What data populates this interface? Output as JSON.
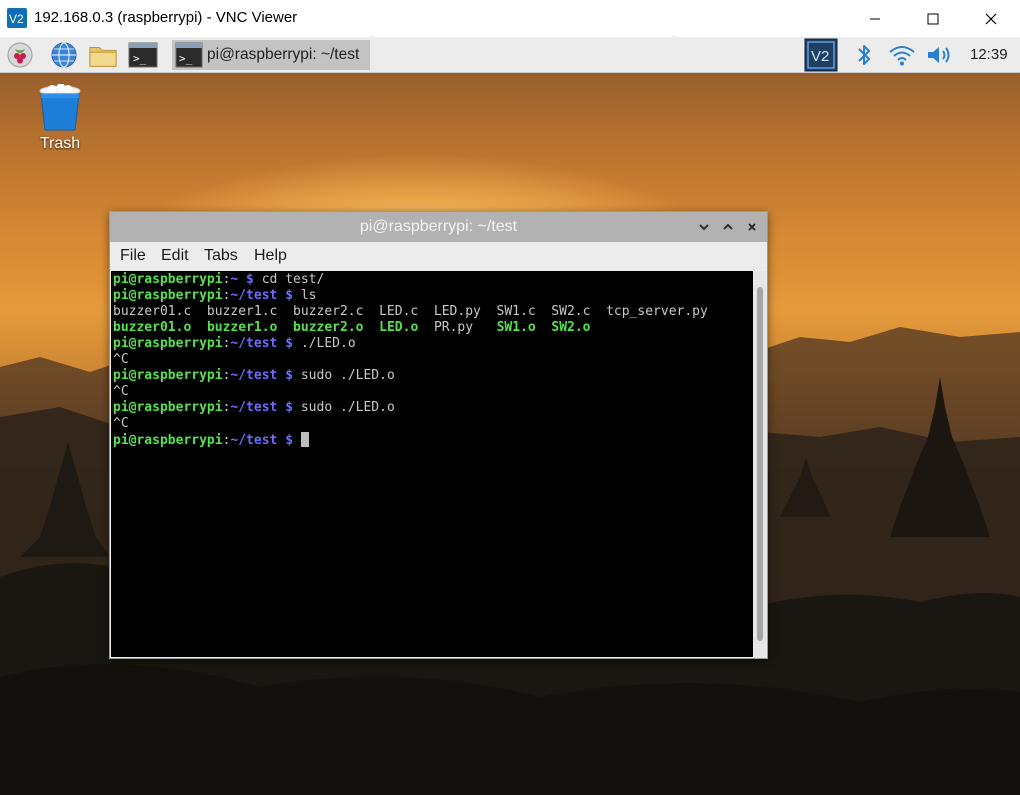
{
  "vnc": {
    "logo_text": "V2",
    "title": "192.168.0.3 (raspberrypi) - VNC Viewer",
    "controls": {
      "minimize_icon": "minimize-icon",
      "maximize_icon": "maximize-icon",
      "close_icon": "close-icon"
    }
  },
  "taskbar": {
    "launchers": [
      {
        "name": "raspberry-menu-icon"
      },
      {
        "name": "web-browser-icon"
      },
      {
        "name": "file-manager-icon"
      },
      {
        "name": "terminal-launcher-icon"
      }
    ],
    "task": {
      "label": "pi@raspberrypi: ~/test",
      "icon": "terminal-icon"
    },
    "tray": {
      "vnc_badge": "V2",
      "icons": [
        "vnc-server-icon",
        "bluetooth-icon",
        "wifi-icon",
        "volume-icon"
      ]
    },
    "clock": "12:39"
  },
  "desktop": {
    "trash_label": "Trash"
  },
  "terminal": {
    "title": "pi@raspberrypi: ~/test",
    "menu": [
      "File",
      "Edit",
      "Tabs",
      "Help"
    ],
    "prompt_user": "pi@raspberrypi",
    "lines": [
      {
        "segments": [
          {
            "t": "pi@raspberrypi",
            "c": "g"
          },
          {
            "t": ":",
            "c": "w"
          },
          {
            "t": "~ $",
            "c": "b"
          },
          {
            "t": " cd test/",
            "c": "w"
          }
        ]
      },
      {
        "segments": [
          {
            "t": "pi@raspberrypi",
            "c": "g"
          },
          {
            "t": ":",
            "c": "w"
          },
          {
            "t": "~/test $",
            "c": "b"
          },
          {
            "t": " ls",
            "c": "w"
          }
        ]
      },
      {
        "segments": [
          {
            "t": "buzzer01.c  buzzer1.c  buzzer2.c  LED.c  LED.py  SW1.c  SW2.c  tcp_server.py",
            "c": "w"
          }
        ]
      },
      {
        "segments": [
          {
            "t": "buzzer01.o",
            "c": "g"
          },
          {
            "t": "  ",
            "c": "w"
          },
          {
            "t": "buzzer1.o",
            "c": "g"
          },
          {
            "t": "  ",
            "c": "w"
          },
          {
            "t": "buzzer2.o",
            "c": "g"
          },
          {
            "t": "  ",
            "c": "w"
          },
          {
            "t": "LED.o",
            "c": "g"
          },
          {
            "t": "  PR.py   ",
            "c": "w"
          },
          {
            "t": "SW1.o",
            "c": "g"
          },
          {
            "t": "  ",
            "c": "w"
          },
          {
            "t": "SW2.o",
            "c": "g"
          }
        ]
      },
      {
        "segments": [
          {
            "t": "pi@raspberrypi",
            "c": "g"
          },
          {
            "t": ":",
            "c": "w"
          },
          {
            "t": "~/test $",
            "c": "b"
          },
          {
            "t": " ./LED.o",
            "c": "w"
          }
        ]
      },
      {
        "segments": [
          {
            "t": "^C",
            "c": "w"
          }
        ]
      },
      {
        "segments": [
          {
            "t": "pi@raspberrypi",
            "c": "g"
          },
          {
            "t": ":",
            "c": "w"
          },
          {
            "t": "~/test $",
            "c": "b"
          },
          {
            "t": " sudo ./LED.o",
            "c": "w"
          }
        ]
      },
      {
        "segments": [
          {
            "t": "^C",
            "c": "w"
          }
        ]
      },
      {
        "segments": [
          {
            "t": "pi@raspberrypi",
            "c": "g"
          },
          {
            "t": ":",
            "c": "w"
          },
          {
            "t": "~/test $",
            "c": "b"
          },
          {
            "t": " sudo ./LED.o",
            "c": "w"
          }
        ]
      },
      {
        "segments": [
          {
            "t": "^C",
            "c": "w"
          }
        ]
      },
      {
        "segments": [
          {
            "t": "pi@raspberrypi",
            "c": "g"
          },
          {
            "t": ":",
            "c": "w"
          },
          {
            "t": "~/test $",
            "c": "b"
          },
          {
            "t": " ",
            "c": "w"
          }
        ],
        "cursor": true
      }
    ]
  },
  "colors": {
    "prompt_user": "#55e14d",
    "prompt_path": "#6b6bff",
    "terminal_bg": "#000000",
    "vnc_blue": "#0e6fb8"
  }
}
